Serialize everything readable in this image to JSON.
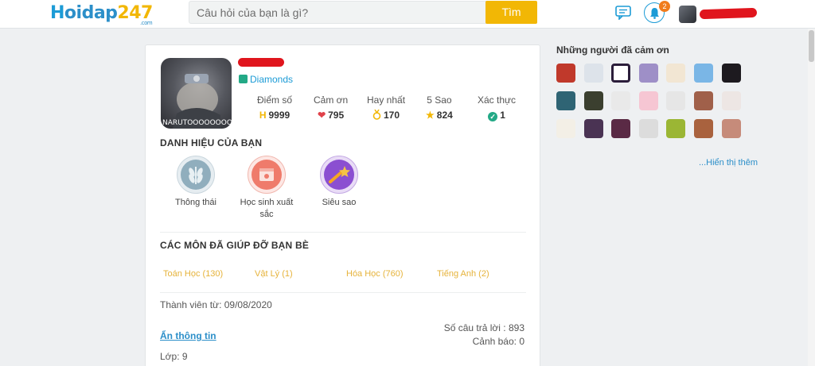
{
  "header": {
    "logo": {
      "h": "H",
      "rest": "oidap",
      "num": "247",
      "com": ".com"
    },
    "search_placeholder": "Câu hỏi của bạn là gì?",
    "search_button": "Tìm",
    "notification_count": "2",
    "chat_icon": "chat-bubble-icon",
    "bell_icon": "bell-icon"
  },
  "profile": {
    "avatar_caption": "NARUTOOOOOOOO",
    "rank": "Diamonds",
    "stats": [
      {
        "label": "Điểm số",
        "value": "9999",
        "icon": "H"
      },
      {
        "label": "Cảm ơn",
        "value": "795",
        "icon": "❤"
      },
      {
        "label": "Hay nhất",
        "value": "170",
        "icon": "medal"
      },
      {
        "label": "5 Sao",
        "value": "824",
        "icon": "★"
      },
      {
        "label": "Xác thực",
        "value": "1",
        "icon": "✓"
      }
    ],
    "titles_heading": "DANH HIỆU CỦA BẠN",
    "titles": [
      {
        "label": "Thông thái"
      },
      {
        "label": "Học sinh xuất sắc"
      },
      {
        "label": "Siêu sao"
      }
    ],
    "subjects_heading": "CÁC MÔN ĐÃ GIÚP ĐỠ BẠN BÈ",
    "subjects": [
      "Toán Học (130)",
      "Vật Lý (1)",
      "Hóa Học (760)",
      "Tiếng Anh (2)"
    ],
    "member_since": "Thành viên từ: 09/08/2020",
    "answers_count": "Số câu trả lời : 893",
    "warnings": "Cảnh báo: 0",
    "hide_info": "Ẩn thông tin",
    "grade": "Lớp: 9"
  },
  "sidebar": {
    "title": "Những người đã cảm ơn",
    "show_more": "...Hiển thị thêm"
  },
  "colors": {
    "brand_blue": "#1c9bd6",
    "brand_yellow": "#f2b705",
    "subject_gold": "#e6b33b",
    "rank_green": "#23a986"
  }
}
